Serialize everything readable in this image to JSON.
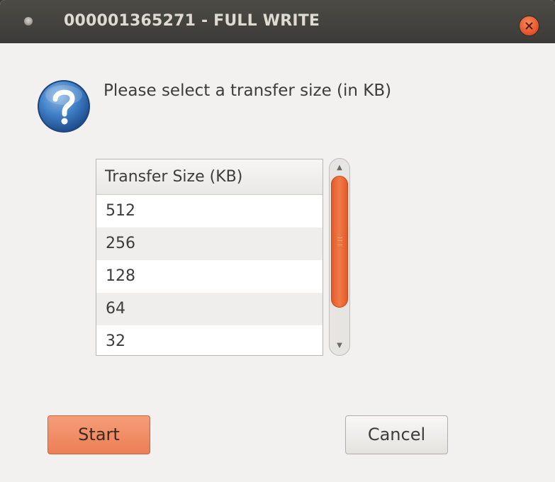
{
  "window": {
    "title": "000001365271 - FULL WRITE"
  },
  "dialog": {
    "prompt": "Please select a transfer size (in KB)",
    "icon": "question-icon"
  },
  "list": {
    "header": "Transfer Size (KB)",
    "rows": [
      "512",
      "256",
      "128",
      "64",
      "32"
    ]
  },
  "buttons": {
    "start_label": "Start",
    "cancel_label": "Cancel"
  },
  "colors": {
    "accent": "#ec7f55",
    "titlebar": "#3c3b37",
    "background": "#f2f1f0"
  }
}
